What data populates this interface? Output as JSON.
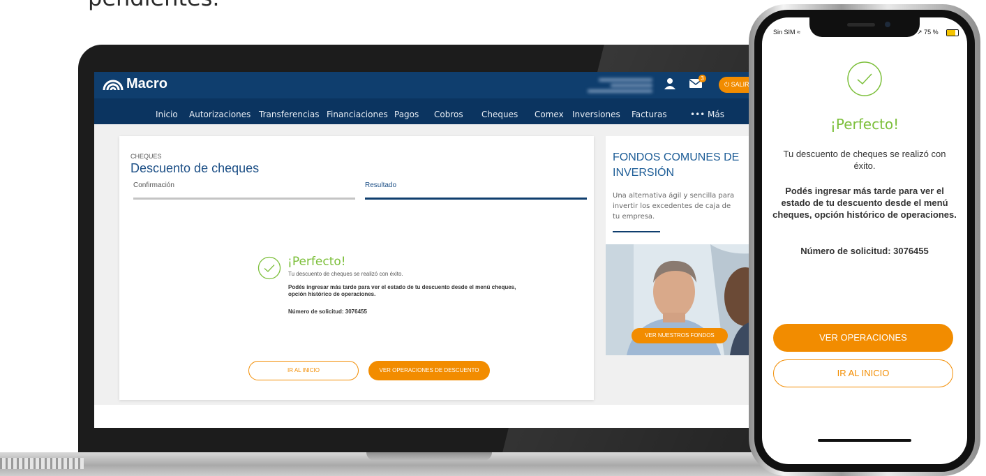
{
  "page": {
    "headline_fragment": "pendientes."
  },
  "desktop": {
    "brand": "Macro",
    "mail_badge": "3",
    "logout_label": "SALIR",
    "nav": [
      "Inicio",
      "Autorizaciones",
      "Transferencias",
      "Financiaciones",
      "Pagos",
      "Cobros",
      "Cheques",
      "Comex",
      "Inversiones",
      "Facturas",
      "••• Más"
    ],
    "card": {
      "section": "CHEQUES",
      "title": "Descuento de cheques",
      "steps": [
        "Confirmación",
        "Resultado"
      ],
      "result_title": "¡Perfecto!",
      "result_message": "Tu descuento de cheques se realizó con éxito.",
      "result_detail": "Podés ingresar más tarde para ver el estado de tu descuento desde el menú cheques, opción histórico de operaciones.",
      "request_number": "Número de solicitud:  3076455",
      "btn_home": "IR AL INICIO",
      "btn_operations": "VER OPERACIONES DE DESCUENTO"
    },
    "side": {
      "title": "FONDOS COMUNES DE INVERSIÓN",
      "text": "Una alternativa ágil y sencilla para invertir los excedentes de caja de tu empresa.",
      "button": "VER NUESTROS FONDOS"
    }
  },
  "mobile": {
    "carrier": "Sin SIM",
    "battery": "75 %",
    "result_title": "¡Perfecto!",
    "result_message": "Tu descuento de cheques se realizó con éxito.",
    "result_detail": "Podés ingresar más tarde para ver el estado de tu descuento desde el menú cheques, opción histórico de operaciones.",
    "request_number": "Número de solicitud:  3076455",
    "btn_operations": "VER OPERACIONES",
    "btn_home": "IR AL INICIO"
  },
  "colors": {
    "brand_navy": "#0f3e6e",
    "accent_orange": "#f28c00",
    "success_green": "#7cbf3a"
  }
}
